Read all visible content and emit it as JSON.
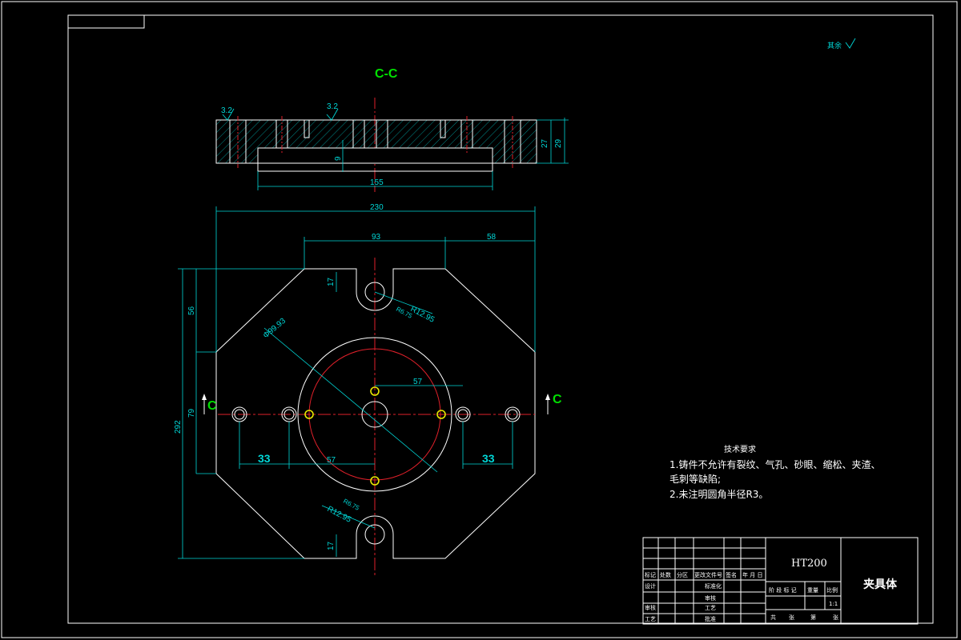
{
  "section_label": "C-C",
  "section_marker": "C",
  "roughness": {
    "left": "3.2",
    "mid": "3.2",
    "corner": "其余"
  },
  "dims": {
    "d155": "155",
    "d27": "27",
    "d29": "29",
    "d9": "9",
    "d230": "230",
    "d93": "93",
    "d58": "58",
    "d56": "56",
    "d79": "79",
    "d292": "292",
    "d17a": "17",
    "d17b": "17",
    "d57a": "57",
    "d57b": "57",
    "d33a": "33",
    "d33b": "33",
    "d_phi": "Φ99.93",
    "r_top1": "R12.95",
    "r_top2": "R6.75",
    "r_bot1": "R12.95",
    "r_bot2": "R6.75"
  },
  "notes": {
    "title": "技术要求",
    "line1": "1.铸件不允许有裂纹、气孔、砂眼、缩松、夹渣、",
    "line2": "毛刺等缺陷;",
    "line3": "2.未注明圆角半径R3。"
  },
  "title_block": {
    "material": "HT200",
    "part_name": "夹具体",
    "h_biaoji": "标记",
    "h_chushu": "处数",
    "h_fenqu": "分区",
    "h_wenjian": "更改文件号",
    "h_qianming": "签名",
    "h_date": "年 月 日",
    "sheji": "设计",
    "biaozhunhua": "标准化",
    "shenhe": "审核",
    "gongyi": "工艺",
    "shenhe2": "审核",
    "pizhun": "批准",
    "jieduan": "阶 段 标 记",
    "zhongliang": "重量",
    "bili": "比例",
    "scale": "1:1",
    "gong": "共",
    "zhang1": "张",
    "di": "第",
    "zhang2": "张"
  }
}
